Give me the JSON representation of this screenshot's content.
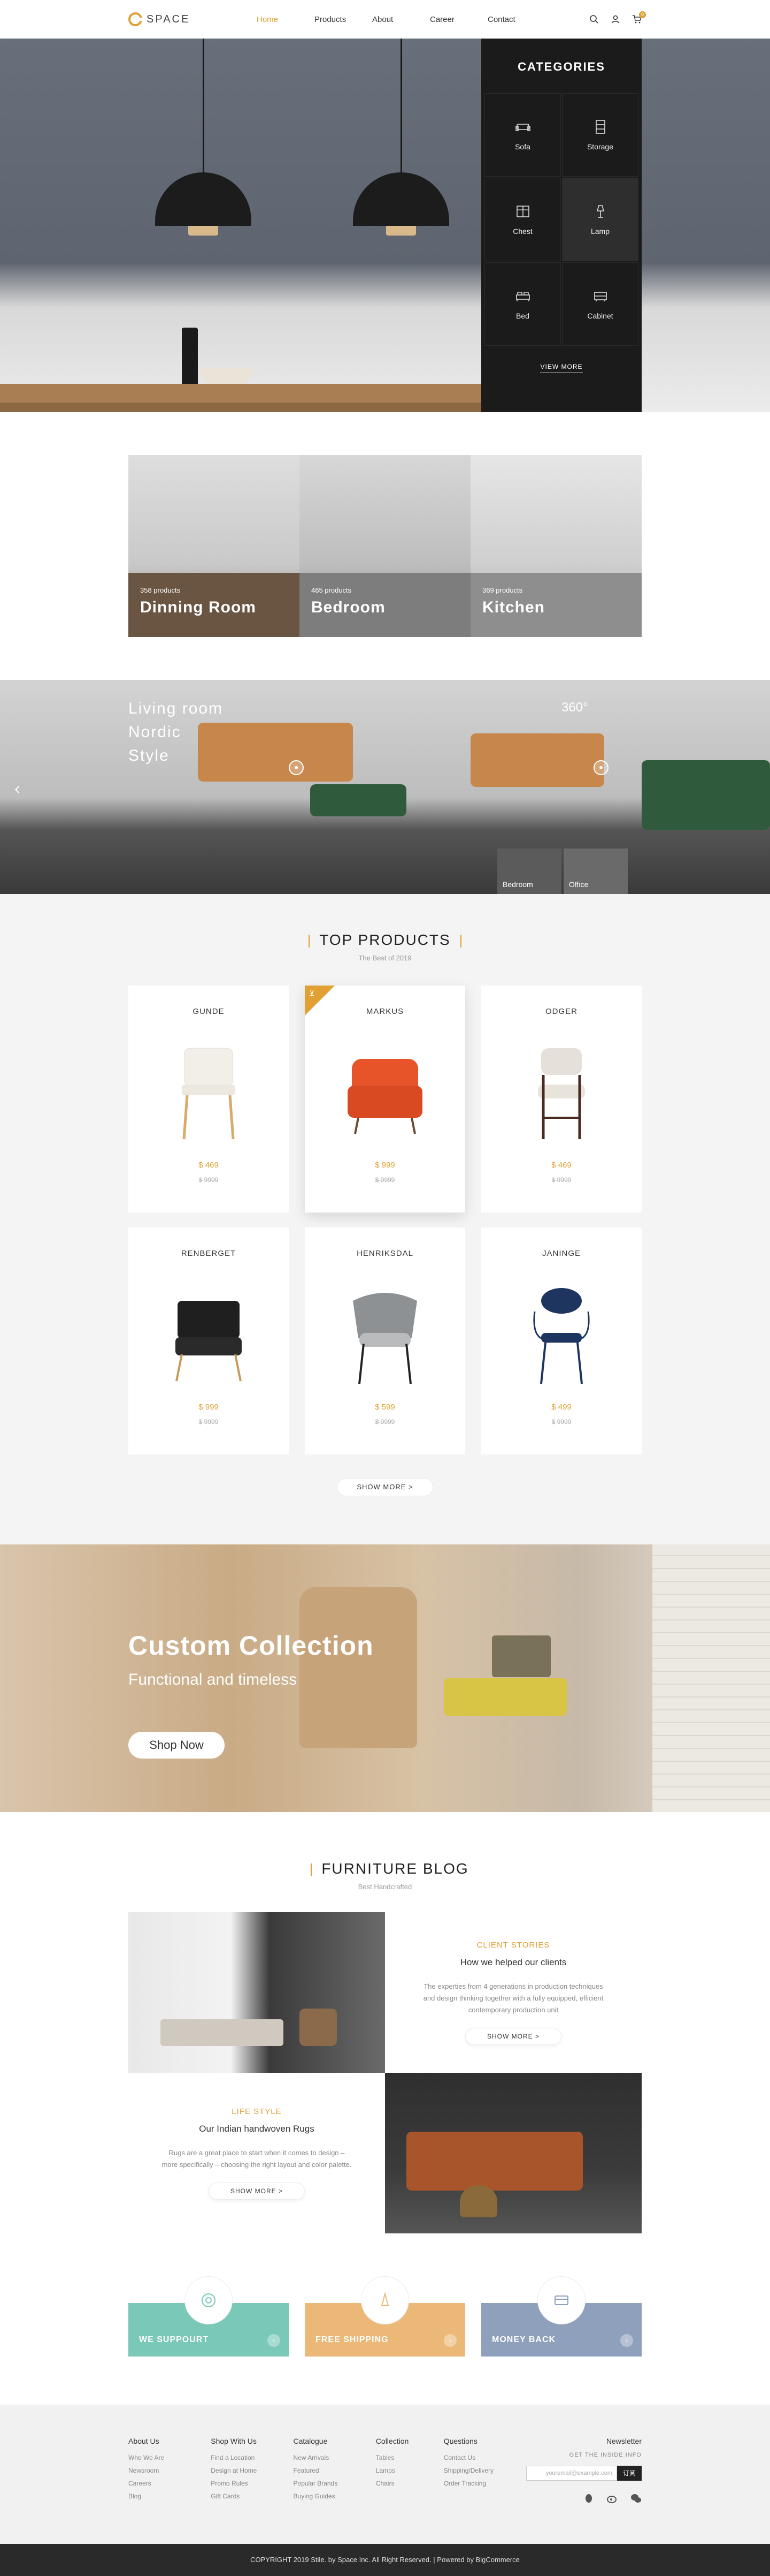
{
  "header": {
    "logo_text": "SPACE",
    "nav": [
      "Home",
      "Products",
      "About",
      "Career",
      "Contact"
    ],
    "active_nav": "Home",
    "cart_count": "0"
  },
  "hero": {
    "categories_title": "CATEGORIES",
    "categories": [
      {
        "label": "Sofa",
        "icon": "sofa-icon"
      },
      {
        "label": "Storage",
        "icon": "storage-icon"
      },
      {
        "label": "Chest",
        "icon": "chest-icon"
      },
      {
        "label": "Lamp",
        "icon": "lamp-icon"
      },
      {
        "label": "Bed",
        "icon": "bed-icon"
      },
      {
        "label": "Cabinet",
        "icon": "cabinet-icon"
      }
    ],
    "view_more": "VIEW MORE"
  },
  "rooms": [
    {
      "count": "358 products",
      "name": "Dinning Room"
    },
    {
      "count": "465 products",
      "name": "Bedroom"
    },
    {
      "count": "369 products",
      "name": "Kitchen"
    }
  ],
  "living": {
    "lines": [
      "Living room",
      "Nordic",
      "Style"
    ],
    "badge": "360°",
    "thumbs": [
      "Bedroom",
      "Office"
    ]
  },
  "top_products": {
    "title": "TOP PRODUCTS",
    "subtitle": "The Best of 2019",
    "items": [
      {
        "name": "GUNDE",
        "price": "$ 469",
        "old": "$ 9999"
      },
      {
        "name": "MARKUS",
        "price": "$ 999",
        "old": "$ 9999"
      },
      {
        "name": "ODGER",
        "price": "$ 469",
        "old": "$ 9999"
      },
      {
        "name": "RENBERGET",
        "price": "$ 999",
        "old": "$ 9999"
      },
      {
        "name": "HENRIKSDAL",
        "price": "$ 599",
        "old": "$ 9999"
      },
      {
        "name": "JANINGE",
        "price": "$ 499",
        "old": "$ 9999"
      }
    ],
    "show_more": "SHOW MORE  >"
  },
  "collection": {
    "title": "Custom Collection",
    "subtitle": "Functional and timeless",
    "button": "Shop Now"
  },
  "blog": {
    "title": "FURNITURE BLOG",
    "subtitle": "Best Handcrafted",
    "posts": [
      {
        "category": "CLIENT STORIES",
        "heading": "How we helped our clients",
        "body": "The experties from 4 generations in production techniques and design thinking together with a fully equipped, efficient contemporary production unit",
        "more": "SHOW MORE  >"
      },
      {
        "category": "LIFE STYLE",
        "heading": "Our Indian handwoven Rugs",
        "body": "Rugs are a great place to start when it comes to design – more specifically – choosing the right layout and color palette.",
        "more": "SHOW MORE  >"
      }
    ]
  },
  "features": [
    {
      "label": "WE SUPPOURT",
      "color": "#7ac8b8"
    },
    {
      "label": "FREE SHIPPING",
      "color": "#ebb878"
    },
    {
      "label": "MONEY BACK",
      "color": "#8fa0bc"
    }
  ],
  "footer": {
    "columns": [
      {
        "title": "About Us",
        "items": [
          "Who We Are",
          "Newsroom",
          "Careers",
          "Blog"
        ]
      },
      {
        "title": "Shop With Us",
        "items": [
          "Find a Location",
          "Design at Home",
          "Promo Rules",
          "Gift Cards"
        ]
      },
      {
        "title": "Catalogue",
        "items": [
          "New Arrivals",
          "Featured",
          "Popular Brands",
          "Buying Guides"
        ]
      },
      {
        "title": "Collection",
        "items": [
          "Tables",
          "Lamps",
          "Chairs"
        ]
      },
      {
        "title": "Questions",
        "items": [
          "Contact Us",
          "Shipping/Delivery",
          "Order Tracking"
        ]
      }
    ],
    "newsletter_title": "Newsletter",
    "newsletter_sub": "GET THE INSIDE INFO",
    "newsletter_placeholder": "youremail@example.com",
    "newsletter_button": "订阅",
    "copyright": "COPYRIGHT 2019 Stile. by Space Inc. All Right Reserved.  |  Powered by BigCommerce"
  },
  "colors": {
    "accent": "#e0a032",
    "dark": "#1b1b1b"
  }
}
